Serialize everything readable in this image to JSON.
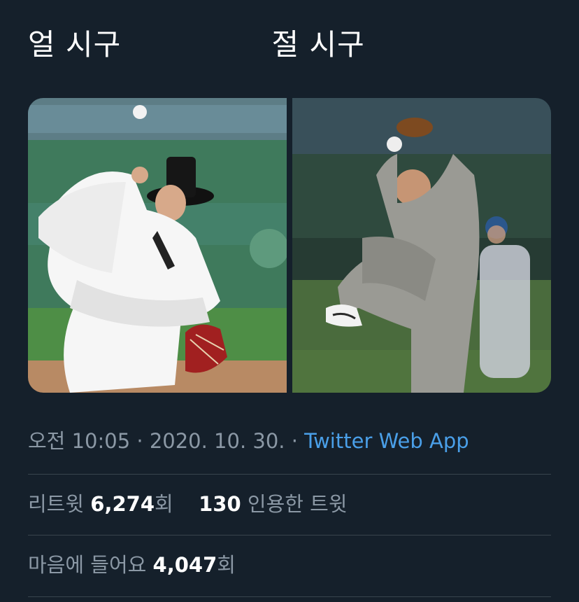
{
  "tweet": {
    "text": "얼 시구               절 시구"
  },
  "media": [
    {
      "icon": "photo-hanbok-pitcher"
    },
    {
      "icon": "photo-monk-pitcher"
    }
  ],
  "meta": {
    "time": "오전 10:05",
    "separator1": " · ",
    "date": "2020. 10. 30.",
    "separator2": " · ",
    "source": "Twitter Web App"
  },
  "stats": {
    "retweets_label": "리트윗 ",
    "retweets_count": "6,274",
    "retweets_unit": "회",
    "quotes_count": "130",
    "quotes_label": " 인용한 트윗",
    "likes_label": "마음에 들어요 ",
    "likes_count": "4,047",
    "likes_unit": "회"
  },
  "colors": {
    "background": "#15202b",
    "secondary_text": "#8b98a5",
    "link": "#4a9fe8",
    "divider": "#38444d"
  }
}
